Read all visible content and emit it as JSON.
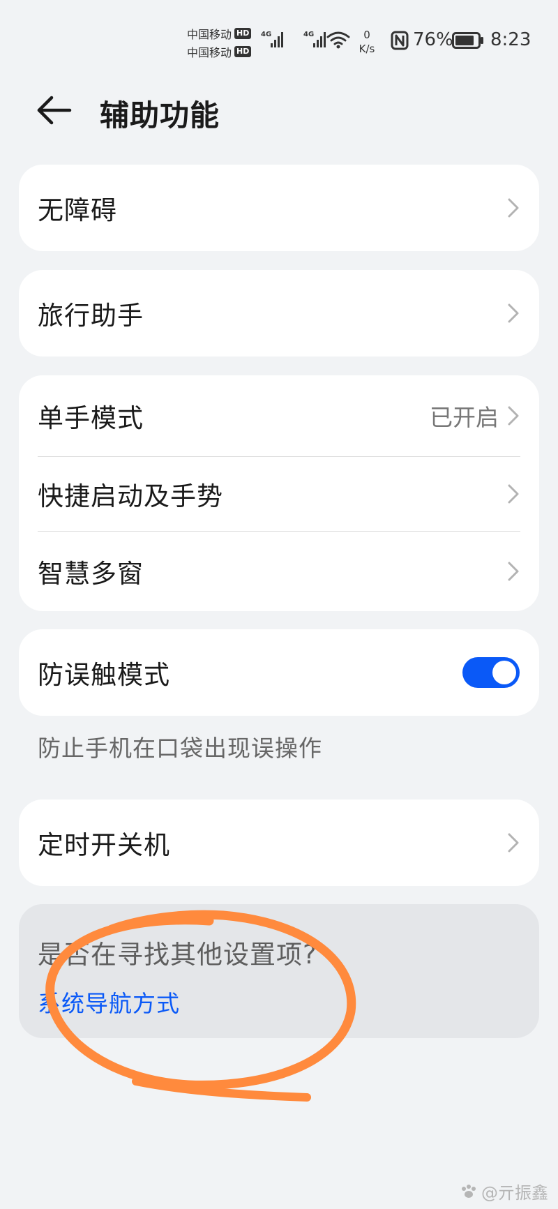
{
  "status_bar": {
    "carrier_1": "中国移动",
    "carrier_2": "中国移动",
    "hd_badge": "HD",
    "network_1": "4G",
    "network_2": "4G",
    "speed_value": "0",
    "speed_unit": "K/s",
    "battery_percent": "76%",
    "time": "8:23"
  },
  "header": {
    "title": "辅助功能"
  },
  "items": {
    "accessibility": {
      "label": "无障碍"
    },
    "travel_assistant": {
      "label": "旅行助手"
    },
    "one_hand_mode": {
      "label": "单手模式",
      "status": "已开启"
    },
    "shortcuts_gestures": {
      "label": "快捷启动及手势"
    },
    "smart_multiwindow": {
      "label": "智慧多窗"
    },
    "accidental_touch": {
      "label": "防误触模式",
      "enabled": true,
      "hint": "防止手机在口袋出现误操作"
    },
    "scheduled_power": {
      "label": "定时开关机"
    }
  },
  "suggestion": {
    "title": "是否在寻找其他设置项?",
    "link": "系统导航方式"
  },
  "watermark": {
    "text": "@亓振鑫"
  },
  "colors": {
    "accent": "#0a59f7",
    "background": "#f1f3f5",
    "card": "#ffffff",
    "annotation": "#ff8a3d"
  }
}
